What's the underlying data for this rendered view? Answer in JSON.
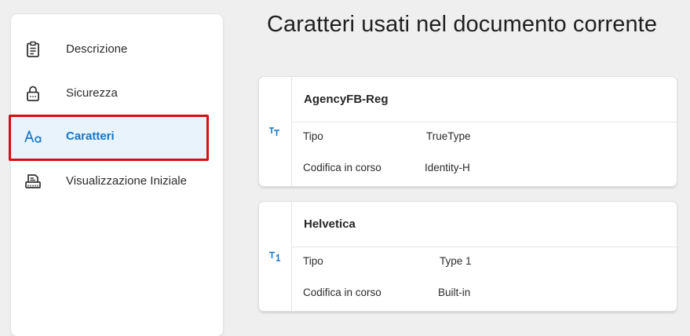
{
  "sidebar": {
    "items": [
      {
        "label": "Descrizione",
        "icon": "clipboard-icon"
      },
      {
        "label": "Sicurezza",
        "icon": "lock-icon"
      },
      {
        "label": "Caratteri",
        "icon": "font-aa-icon",
        "active": true
      },
      {
        "label": "Visualizzazione Iniziale",
        "icon": "initial-view-icon"
      }
    ]
  },
  "main": {
    "title": "Caratteri usati nel documento corrente",
    "fonts": [
      {
        "name": "AgencyFB-Reg",
        "icon": "truetype-font-icon",
        "type_label": "Tipo",
        "type_value": "TrueType",
        "encoding_label": "Codifica in corso",
        "encoding_value": "Identity-H"
      },
      {
        "name": "Helvetica",
        "icon": "type1-font-icon",
        "type_label": "Tipo",
        "type_value": "Type 1",
        "encoding_label": "Codifica in corso",
        "encoding_value": "Built-in"
      }
    ]
  },
  "colors": {
    "accent": "#1677c7",
    "active_background": "#e8f3fc",
    "highlight_border": "#d60f0f"
  }
}
